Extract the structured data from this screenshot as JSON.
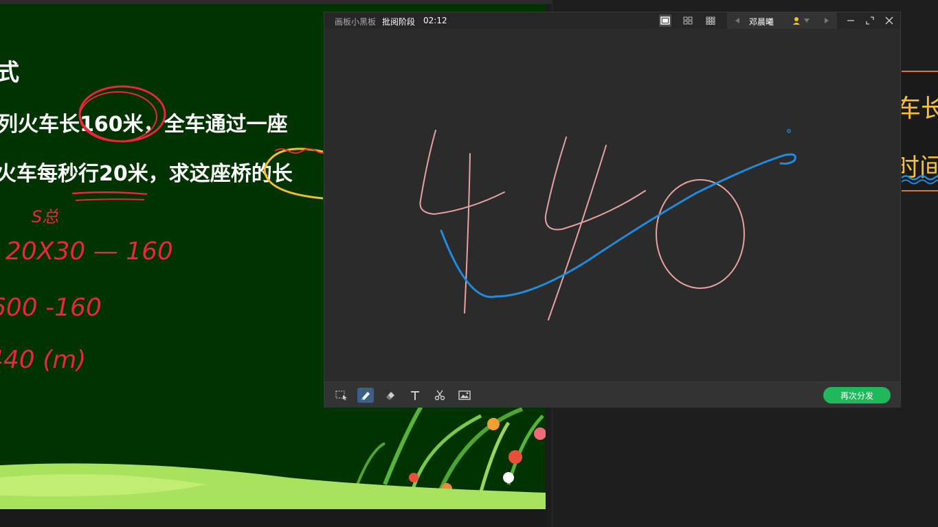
{
  "slide": {
    "heading_partial": "式",
    "line1": "列火车长160米，全车通过一座",
    "line2": "火车每秒行20米，求这座桥的长",
    "annot_s": "S总",
    "annot_eq1": "20X30 — 160",
    "annot_eq2": "600 -160",
    "annot_eq3": "440 (m)"
  },
  "side_cards": {
    "card1_text": "车长",
    "card2_text": "时间"
  },
  "whiteboard": {
    "title": "画板小黑板",
    "phase": "批阅阶段",
    "timer": "02:12",
    "student_name": "邓晨曦",
    "redistribute_label": "再次分发",
    "handwriting": "440",
    "colors": {
      "pink_stroke": "#e8a3a0",
      "blue_stroke": "#1e8de0",
      "accent_green": "#1fb85a",
      "slide_bg": "#013301",
      "annotation_red": "#e8283a",
      "annotation_yellow": "#f0c030"
    }
  }
}
